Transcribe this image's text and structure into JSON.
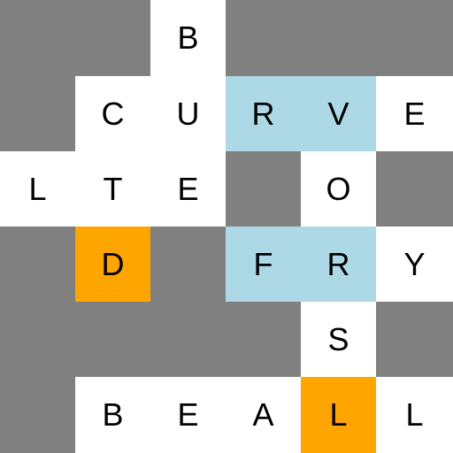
{
  "colors": {
    "background": "#808080",
    "white": "#ffffff",
    "blue": "#add8e6",
    "orange": "#ffa500",
    "text": "#000000"
  },
  "board": {
    "rows": 6,
    "cols": 6,
    "grid": [
      [
        null,
        null,
        {
          "letter": "B",
          "state": "white"
        },
        null,
        null,
        null
      ],
      [
        null,
        {
          "letter": "C",
          "state": "white"
        },
        {
          "letter": "U",
          "state": "white"
        },
        {
          "letter": "R",
          "state": "blue"
        },
        {
          "letter": "V",
          "state": "blue"
        },
        {
          "letter": "E",
          "state": "white"
        }
      ],
      [
        {
          "letter": "L",
          "state": "white"
        },
        {
          "letter": "T",
          "state": "white"
        },
        {
          "letter": "E",
          "state": "white"
        },
        null,
        {
          "letter": "O",
          "state": "white"
        },
        null
      ],
      [
        null,
        {
          "letter": "D",
          "state": "orange"
        },
        null,
        {
          "letter": "F",
          "state": "blue"
        },
        {
          "letter": "R",
          "state": "blue"
        },
        {
          "letter": "Y",
          "state": "white"
        }
      ],
      [
        null,
        null,
        null,
        null,
        {
          "letter": "S",
          "state": "white"
        },
        null
      ],
      [
        null,
        {
          "letter": "B",
          "state": "white"
        },
        {
          "letter": "E",
          "state": "white"
        },
        {
          "letter": "A",
          "state": "white"
        },
        {
          "letter": "L",
          "state": "orange"
        },
        {
          "letter": "L",
          "state": "white"
        }
      ]
    ]
  }
}
